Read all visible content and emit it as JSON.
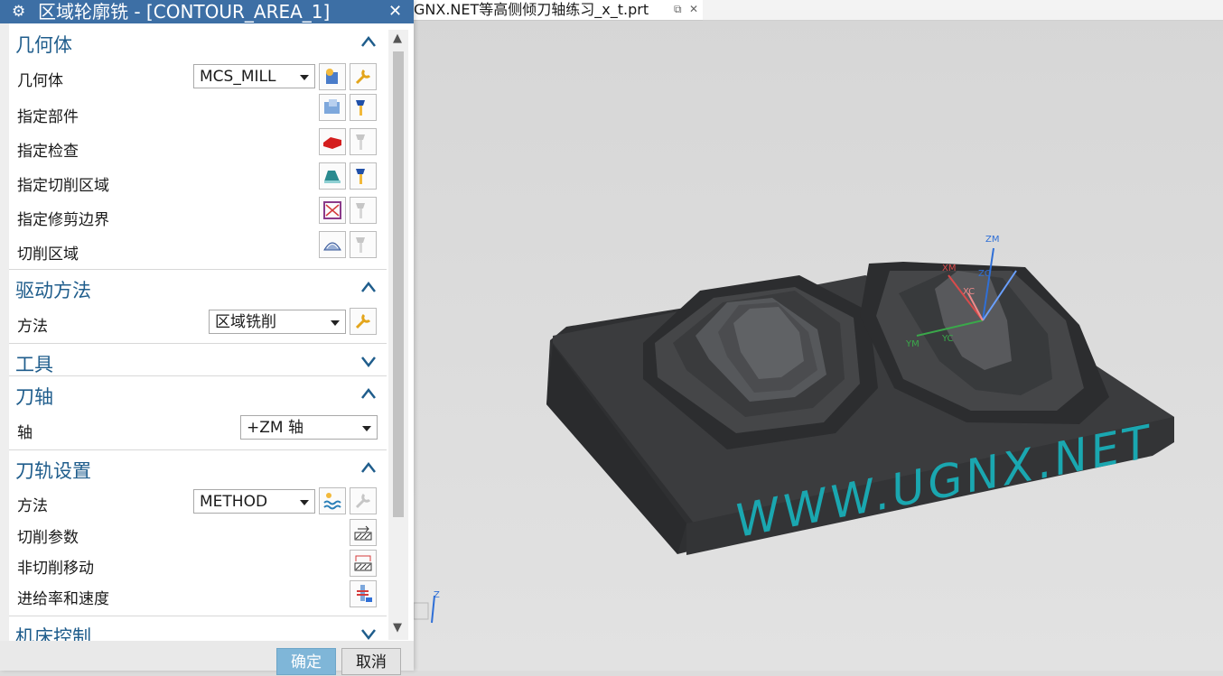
{
  "dialog": {
    "title": "区域轮廓铣 - [CONTOUR_AREA_1]",
    "close_glyph": "✕",
    "ok_label": "确定",
    "cancel_label": "取消"
  },
  "file_tab": {
    "label": "GNX.NET等高侧倾刀轴练习_x_t.prt",
    "close_glyph": "✕"
  },
  "sections": {
    "geometry": {
      "title": "几何体",
      "geometry_label": "几何体",
      "geometry_value": "MCS_MILL",
      "rows": [
        "指定部件",
        "指定检查",
        "指定切削区域",
        "指定修剪边界",
        "切削区域"
      ]
    },
    "drive": {
      "title": "驱动方法",
      "method_label": "方法",
      "method_value": "区域铣削"
    },
    "tool": {
      "title": "工具"
    },
    "axis": {
      "title": "刀轴",
      "axis_label": "轴",
      "axis_value": "+ZM 轴"
    },
    "path": {
      "title": "刀轨设置",
      "method_label": "方法",
      "method_value": "METHOD",
      "rows": [
        "切削参数",
        "非切削移动",
        "进给率和速度"
      ]
    },
    "machine": {
      "title": "机床控制"
    }
  },
  "viewport": {
    "engraving_text": "WWW.UGNX.NET",
    "axes": {
      "zm": "ZM",
      "ym": "YM",
      "yc": "YC",
      "zc": "ZC",
      "xm": "XM",
      "xc": "XC",
      "z": "Z"
    }
  },
  "colors": {
    "title_bar": "#3d6fa5",
    "section_title": "#1f5d8c",
    "ok_button": "#7fb6d8",
    "part": "#3a3b3d",
    "engraving": "#1aa7b0"
  }
}
